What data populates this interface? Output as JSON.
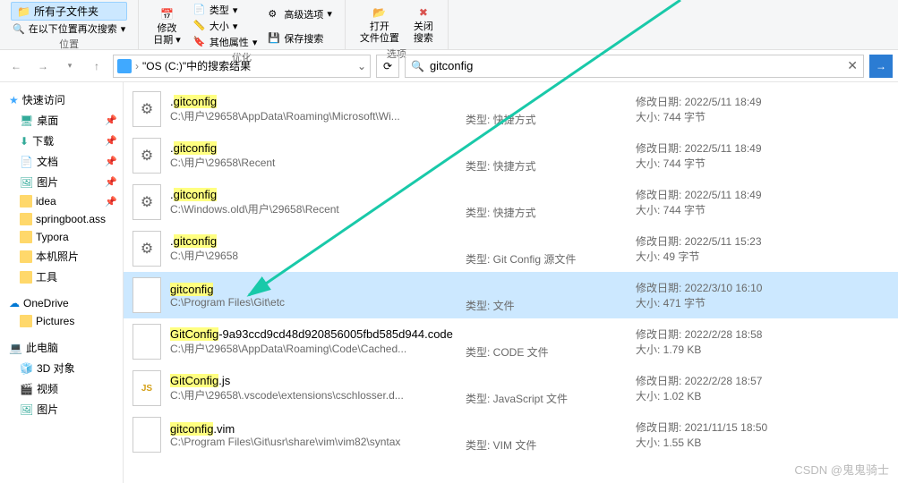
{
  "ribbon": {
    "group1": {
      "label": "位置",
      "all_subfolders": "所有子文件夹",
      "search_again": "在以下位置再次搜索"
    },
    "group2": {
      "label": "优化",
      "modify_date": "修改",
      "date_sub": "日期",
      "type": "类型",
      "size": "大小",
      "other_props": "其他属性",
      "advanced": "高级选项",
      "save_search": "保存搜索"
    },
    "group3": {
      "label": "选项",
      "open_loc1": "打开",
      "open_loc2": "文件位置",
      "close1": "关闭",
      "close2": "搜索"
    }
  },
  "breadcrumb": {
    "text": "\"OS (C:)\"中的搜索结果"
  },
  "search": {
    "value": "gitconfig"
  },
  "nav": {
    "quick": "快速访问",
    "desktop": "桌面",
    "downloads": "下载",
    "documents": "文档",
    "pictures": "图片",
    "idea": "idea",
    "springboot": "springboot.ass",
    "typora": "Typora",
    "local_photos": "本机照片",
    "tools": "工具",
    "onedrive": "OneDrive",
    "pictures2": "Pictures",
    "thispc": "此电脑",
    "objects3d": "3D 对象",
    "video": "视频",
    "pictures3": "图片"
  },
  "labels": {
    "type_prefix": "类型:",
    "moddate_prefix": "修改日期:",
    "size_prefix": "大小:"
  },
  "results": [
    {
      "name_pre": ".",
      "name_hl": "gitconfig",
      "name_post": "",
      "path": "C:\\用户\\29658\\AppData\\Roaming\\Microsoft\\Wi...",
      "type": "快捷方式",
      "date": "2022/5/11 18:49",
      "size": "744 字节",
      "ico": "gear"
    },
    {
      "name_pre": ".",
      "name_hl": "gitconfig",
      "name_post": "",
      "path": "C:\\用户\\29658\\Recent",
      "type": "快捷方式",
      "date": "2022/5/11 18:49",
      "size": "744 字节",
      "ico": "gear"
    },
    {
      "name_pre": ".",
      "name_hl": "gitconfig",
      "name_post": "",
      "path": "C:\\Windows.old\\用户\\29658\\Recent",
      "type": "快捷方式",
      "date": "2022/5/11 18:49",
      "size": "744 字节",
      "ico": "gear"
    },
    {
      "name_pre": ".",
      "name_hl": "gitconfig",
      "name_post": "",
      "path": "C:\\用户\\29658",
      "type": "Git Config 源文件",
      "date": "2022/5/11 15:23",
      "size": "49 字节",
      "ico": "gear"
    },
    {
      "name_pre": "",
      "name_hl": "gitconfig",
      "name_post": "",
      "path": "C:\\Program Files\\Git\\etc",
      "type": "文件",
      "date": "2022/3/10 16:10",
      "size": "471 字节",
      "ico": "plain",
      "selected": true
    },
    {
      "name_pre": "",
      "name_hl": "GitConfig",
      "name_post": "-9a93ccd9cd48d920856005fbd585d944.code",
      "path": "C:\\用户\\29658\\AppData\\Roaming\\Code\\Cached...",
      "type": "CODE 文件",
      "date": "2022/2/28 18:58",
      "size": "1.79 KB",
      "ico": "plain"
    },
    {
      "name_pre": "",
      "name_hl": "GitConfig",
      "name_post": ".js",
      "path": "C:\\用户\\29658\\.vscode\\extensions\\cschlosser.d...",
      "type": "JavaScript 文件",
      "date": "2022/2/28 18:57",
      "size": "1.02 KB",
      "ico": "js"
    },
    {
      "name_pre": "",
      "name_hl": "gitconfig",
      "name_post": ".vim",
      "path": "C:\\Program Files\\Git\\usr\\share\\vim\\vim82\\syntax",
      "type": "VIM 文件",
      "date": "2021/11/15 18:50",
      "size": "1.55 KB",
      "ico": "plain"
    }
  ],
  "watermark": "CSDN @鬼鬼骑士"
}
